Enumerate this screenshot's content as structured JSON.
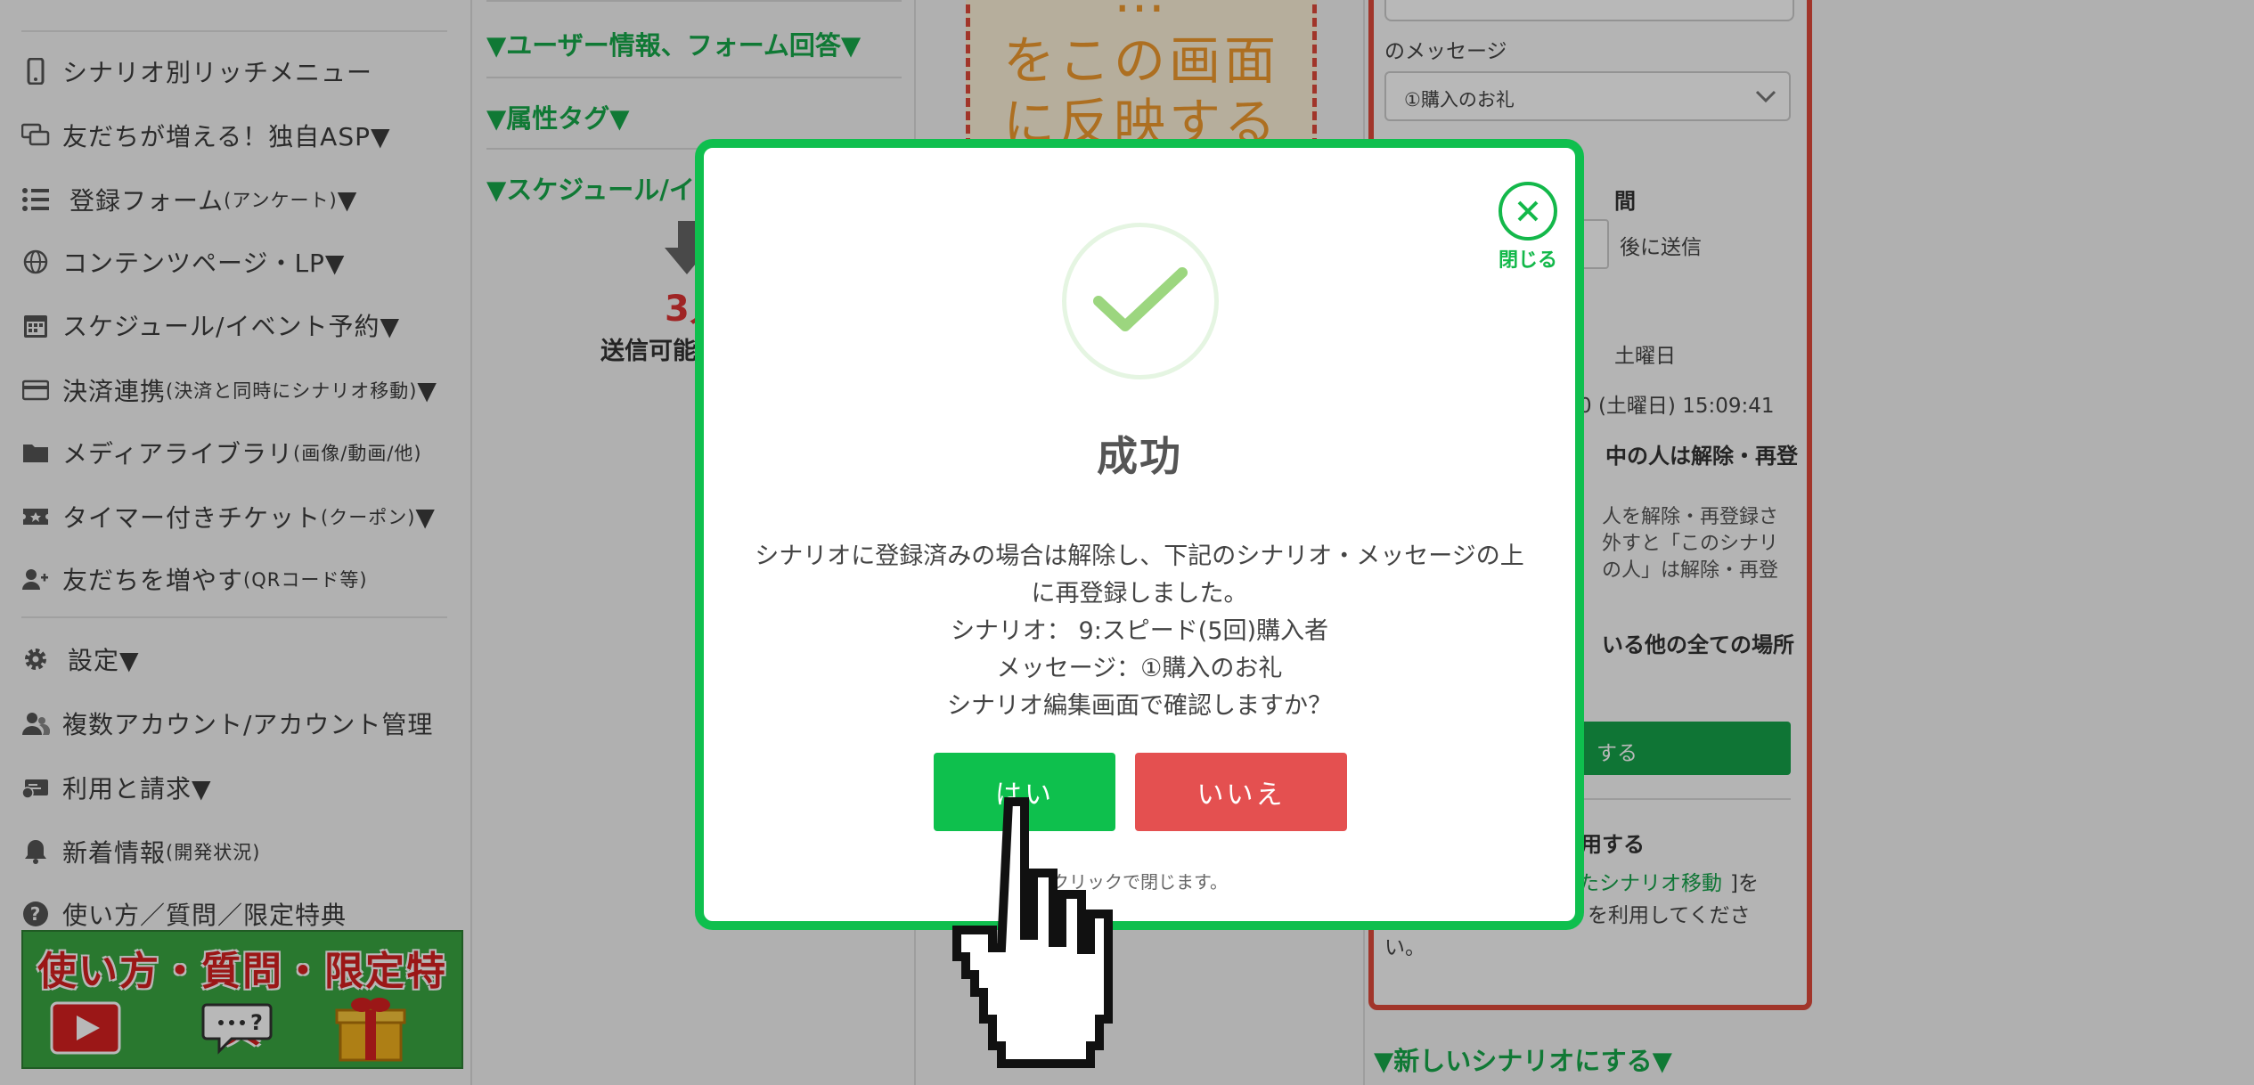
{
  "sidebar": {
    "items": [
      {
        "label": "シナリオ別リッチメニュー",
        "small": "",
        "icon": "smartphone-icon"
      },
      {
        "label": "友だちが増える！独自ASP▼",
        "small": "",
        "icon": "chat-icon"
      },
      {
        "label": "登録フォーム",
        "small": "(アンケート)",
        "suffix": "▼",
        "icon": "list-icon"
      },
      {
        "label": "コンテンツページ・LP▼",
        "small": "",
        "icon": "globe-icon"
      },
      {
        "label": "スケジュール/イベント予約▼",
        "small": "",
        "icon": "calendar-icon"
      },
      {
        "label": "決済連携",
        "small": "(決済と同時にシナリオ移動)",
        "suffix": "▼",
        "icon": "credit-card-icon"
      },
      {
        "label": "メディアライブラリ",
        "small": "(画像/動画/他)",
        "suffix": "",
        "icon": "folder-icon"
      },
      {
        "label": "タイマー付きチケット",
        "small": "(クーポン)",
        "suffix": "▼",
        "icon": "ticket-icon"
      },
      {
        "label": "友だちを増やす",
        "small": "(QRコード等)",
        "suffix": "",
        "icon": "user-plus-icon"
      },
      {
        "label": "設定▼",
        "small": "",
        "icon": "gear-icon"
      },
      {
        "label": "複数アカウント/アカウント管理",
        "small": "",
        "icon": "users-icon"
      },
      {
        "label": "利用と請求▼",
        "small": "",
        "icon": "billing-icon"
      },
      {
        "label": "新着情報",
        "small": "(開発状況)",
        "suffix": "",
        "icon": "bell-icon"
      },
      {
        "label": "使い方／質問／限定特典",
        "small": "",
        "icon": "question-icon"
      }
    ],
    "banner_text": "使い方・質問・限定特典"
  },
  "middle": {
    "sections": [
      "▼ユーザー情報、フォーム回答▼",
      "▼属性タグ▼",
      "▼スケジュール/イ"
    ],
    "count": "3人",
    "sendable": "送信可能"
  },
  "preview": {
    "line1": "…",
    "line2": "をこの画面",
    "line3": "に反映する"
  },
  "right": {
    "message_label": "のメッセージ",
    "message_select": "①購入のお礼",
    "time_label": "間",
    "after_send": "後に送信",
    "weekday": "土曜日",
    "datetime": "0 (土曜日) 15:09:41",
    "bold_line1": "中の人は解除・再登",
    "para1": "人を解除・再登録さ",
    "para2": "外すと「このシナリ",
    "para3": "の人」は解除・再登",
    "bold_line2": "いる他の全ての場所",
    "green_btn": "する",
    "use_label": "用する",
    "link_text": "たシナリオ移動",
    "link_after": "]を",
    "para4": "を利用してくださ",
    "para5": "い。",
    "new_scenario": "▼新しいシナリオにする▼"
  },
  "modal": {
    "close_label": "閉じる",
    "title": "成功",
    "body_line1": "シナリオに登録済みの場合は解除し、下記のシナリオ・メッセージの上",
    "body_line2": "に再登録しました。",
    "body_line3": "シナリオ： 9:スピード(5回)購入者",
    "body_line4": "メッセージ：①購入のお礼",
    "body_line5": "シナリオ編集画面で確認しますか？",
    "yes": "はい",
    "no": "いいえ",
    "footer": "クリックで閉じます。"
  },
  "colors": {
    "accent": "#0fbf4e",
    "danger": "#e45050",
    "heading_green": "#17a84a"
  }
}
